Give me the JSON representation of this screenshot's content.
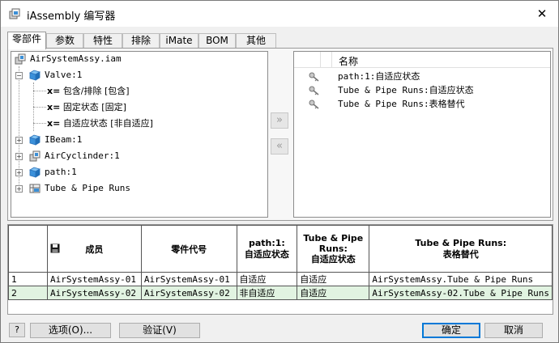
{
  "window": {
    "title": "iAssembly 编写器",
    "close_glyph": "✕"
  },
  "tabs": [
    {
      "label": "零部件",
      "active": true
    },
    {
      "label": "参数"
    },
    {
      "label": "特性"
    },
    {
      "label": "排除"
    },
    {
      "label": "iMate"
    },
    {
      "label": "BOM"
    },
    {
      "label": "其他"
    }
  ],
  "tree": {
    "root": "AirSystemAssy.iam",
    "items": [
      {
        "label": "Valve:1",
        "expanded": true,
        "icon": "part-cube-icon",
        "children": [
          {
            "prefix": "x=",
            "label": "包含/排除 [包含]"
          },
          {
            "prefix": "x=",
            "label": "固定状态 [固定]"
          },
          {
            "prefix": "x=",
            "label": "自适应状态 [非自适应]"
          }
        ]
      },
      {
        "label": "IBeam:1",
        "icon": "part-cube-icon"
      },
      {
        "label": "AirCyclinder:1",
        "icon": "assembly-icon"
      },
      {
        "label": "path:1",
        "icon": "part-cube-icon"
      },
      {
        "label": "Tube & Pipe Runs",
        "icon": "tube-pipe-icon"
      }
    ]
  },
  "transfer": {
    "add_glyph": "»",
    "remove_glyph": "«"
  },
  "attributes": {
    "header": "名称",
    "items": [
      {
        "label": "path:1:自适应状态",
        "icon": "key-icon"
      },
      {
        "label": "Tube & Pipe Runs:自适应状态",
        "icon": "key-icon"
      },
      {
        "label": "Tube & Pipe Runs:表格替代",
        "icon": "key-icon"
      }
    ]
  },
  "table": {
    "columns": [
      "成员",
      "零件代号",
      "path:1:\n自适应状态",
      "Tube & Pipe\nRuns:\n自适应状态",
      "Tube & Pipe Runs:\n表格替代"
    ],
    "rows": [
      {
        "index": "1",
        "cells": [
          "AirSystemAssy-01",
          "AirSystemAssy-01",
          "自适应",
          "自适应",
          "AirSystemAssy.Tube & Pipe Runs"
        ]
      },
      {
        "index": "2",
        "cells": [
          "AirSystemAssy-02",
          "AirSystemAssy-02",
          "非自适应",
          "自适应",
          "AirSystemAssy-02.Tube & Pipe Runs"
        ]
      }
    ]
  },
  "buttons": {
    "help": "?",
    "options": "选项(O)...",
    "verify": "验证(V)",
    "ok": "确定",
    "cancel": "取消"
  }
}
